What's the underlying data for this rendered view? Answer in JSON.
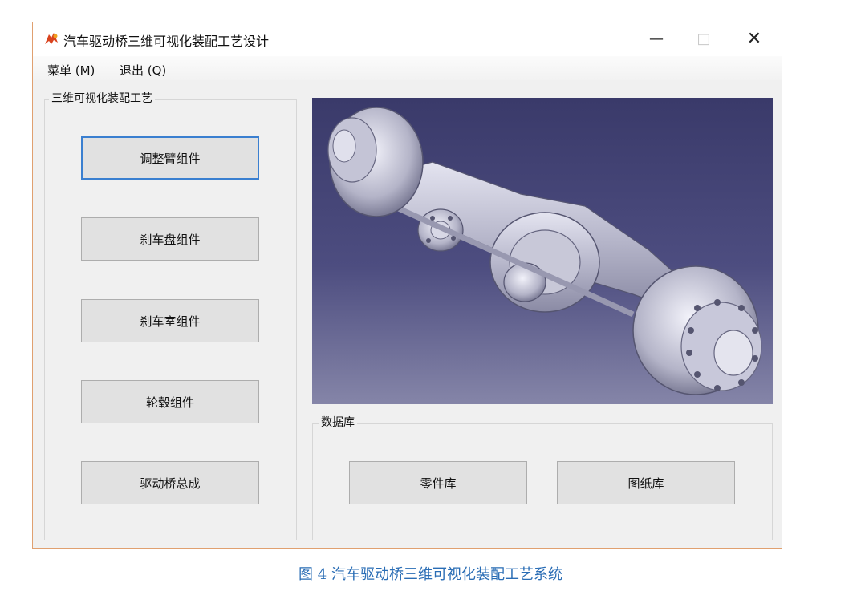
{
  "window": {
    "title": "汽车驱动桥三维可视化装配工艺设计",
    "icon": "app-logo-icon",
    "controls": {
      "minimize": "—",
      "maximize": "□",
      "close": "✕"
    }
  },
  "menubar": {
    "items": [
      {
        "label": "菜单 (M)"
      },
      {
        "label": "退出 (Q)"
      }
    ]
  },
  "left_group": {
    "title": "三维可视化装配工艺",
    "buttons": [
      {
        "label": "调整臂组件",
        "focused": true
      },
      {
        "label": "刹车盘组件"
      },
      {
        "label": "刹车室组件"
      },
      {
        "label": "轮毂组件"
      },
      {
        "label": "驱动桥总成"
      }
    ]
  },
  "viewport": {
    "content": "drive-axle-3d-model"
  },
  "database_group": {
    "title": "数据库",
    "buttons": [
      {
        "label": "零件库"
      },
      {
        "label": "图纸库"
      }
    ]
  },
  "caption": {
    "text": "图 4  汽车驱动桥三维可视化装配工艺系统"
  },
  "colors": {
    "window_border": "#e0a070",
    "focus_border": "#3a7fd0",
    "caption": "#2a6db5",
    "viewport_top": "#3a3a6a",
    "viewport_bottom": "#8585a8"
  }
}
